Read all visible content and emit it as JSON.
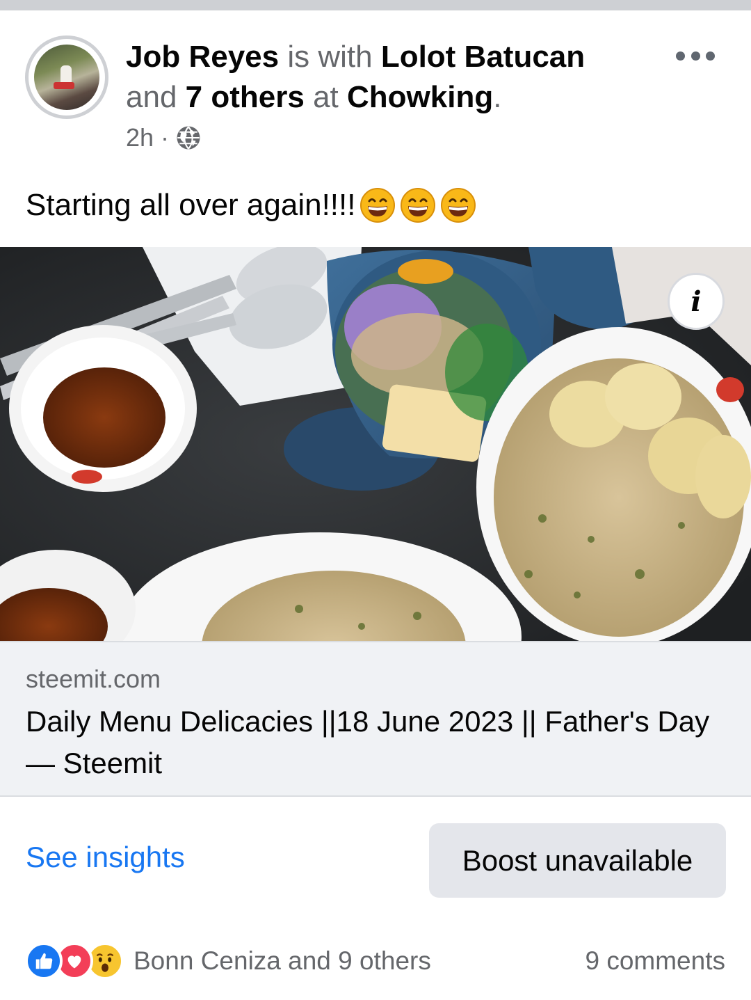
{
  "post": {
    "author": "Job Reyes",
    "with_text": "is with",
    "tagged": "Lolot Batucan",
    "and_text": "and",
    "others": "7 others",
    "at_text": "at",
    "place": "Chowking",
    "period": ".",
    "time": "2h",
    "separator": "·",
    "privacy_icon": "globe-icon",
    "caption": "Starting all over again!!!!",
    "caption_emoji": "grinning-squinting-face x3"
  },
  "link_preview": {
    "domain": "steemit.com",
    "title": "Daily Menu Delicacies ||18 June 2023 || Father's Day — Steemit"
  },
  "actions": {
    "insights_label": "See insights",
    "boost_label": "Boost unavailable"
  },
  "footer": {
    "reactions_text": "Bonn Ceniza and 9 others",
    "comments_text": "9 comments",
    "reaction_icons": [
      "like-icon",
      "love-icon",
      "wow-icon"
    ]
  },
  "colors": {
    "link_blue": "#1877f2",
    "secondary_text": "#65676b",
    "button_gray": "#e4e6eb"
  }
}
